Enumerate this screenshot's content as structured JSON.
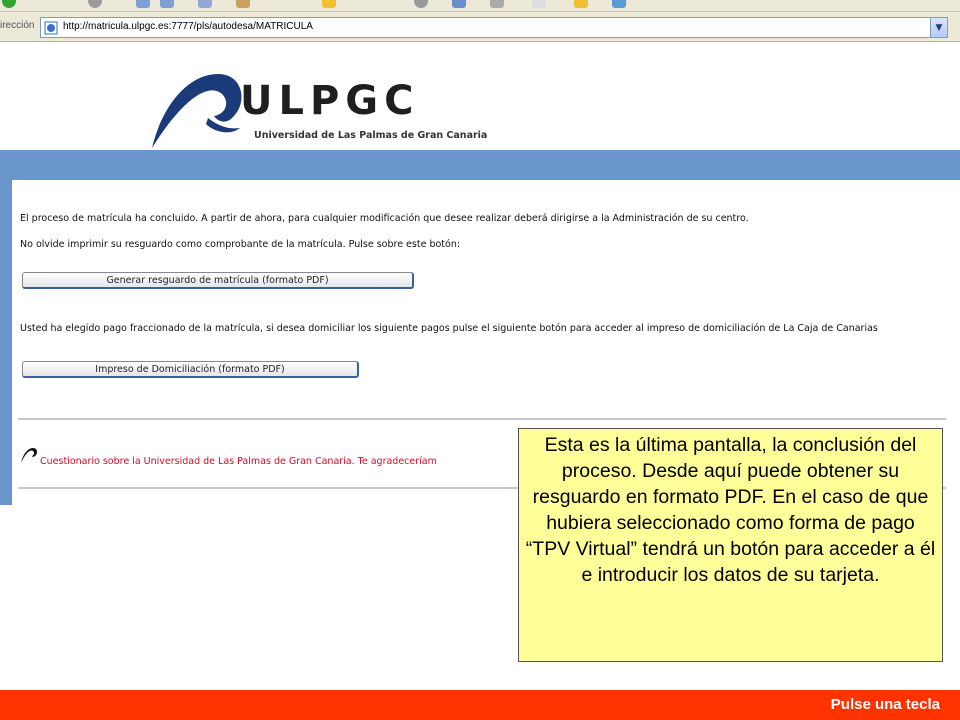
{
  "browser": {
    "address_label": "irección",
    "url": "http://matricula.ulpgc.es:7777/pls/autodesa/MATRICULA",
    "dropdown_glyph": "▼"
  },
  "header": {
    "logo_text": "ULPGC",
    "logo_subtitle": "Universidad de Las Palmas de Gran Canaria"
  },
  "main": {
    "message_1": "El proceso de matrícula ha concluido. A partir de ahora, para cualquier modificación que desee realizar deberá dirigirse a la Administración de su centro.",
    "message_2": "No olvide imprimir su resguardo como comprobante de la matrícula. Pulse sobre este botón:",
    "receipt_button": "Generar resguardo de matrícula (formato PDF)",
    "installment_text": "Usted ha elegido pago fraccionado de la matrícula, si desea domiciliar los siguiente pagos pulse el siguiente botón para acceder al impreso de domiciliación de La Caja de Canarias",
    "direct_debit_button": "Impreso de Domiciliación (formato PDF)",
    "survey_link": "Cuestionario sobre la Universidad de Las Palmas de Gran Canaria. Te agradeceríam"
  },
  "callout": {
    "text": "Esta es la última pantalla, la conclusión del proceso. Desde aquí puede obtener su resguardo en formato PDF. En el caso de que hubiera seleccionado como forma de pago “TPV Virtual” tendrá un botón para acceder a él e introducir los datos de su tarjeta."
  },
  "footer": {
    "label": "Pulse una tecla"
  },
  "colors": {
    "band_blue": "#6a96cc",
    "footer_red": "#ff3300",
    "callout_yellow": "#ffff99",
    "link_red": "#c8102e",
    "logo_navy": "#1a3a7a"
  }
}
